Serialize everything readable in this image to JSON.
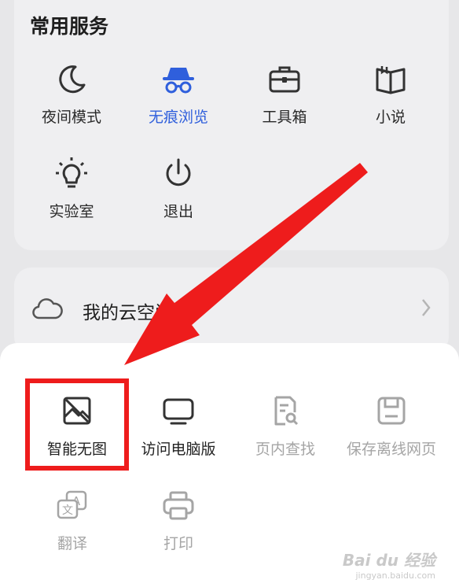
{
  "services": {
    "title": "常用服务",
    "items": [
      {
        "label": "夜间模式",
        "icon": "moon-icon"
      },
      {
        "label": "无痕浏览",
        "icon": "incognito-icon"
      },
      {
        "label": "工具箱",
        "icon": "toolbox-icon"
      },
      {
        "label": "小说",
        "icon": "book-icon"
      },
      {
        "label": "实验室",
        "icon": "bulb-icon"
      },
      {
        "label": "退出",
        "icon": "power-icon"
      }
    ]
  },
  "cloud": {
    "label": "我的云空间",
    "icon": "cloud-icon"
  },
  "tools": {
    "items": [
      {
        "label": "智能无图",
        "icon": "no-image-icon"
      },
      {
        "label": "访问电脑版",
        "icon": "monitor-icon"
      },
      {
        "label": "页内查找",
        "icon": "page-search-icon"
      },
      {
        "label": "保存离线网页",
        "icon": "save-offline-icon"
      },
      {
        "label": "翻译",
        "icon": "translate-icon"
      },
      {
        "label": "打印",
        "icon": "print-icon"
      }
    ]
  },
  "colors": {
    "accent": "#2f5fdc",
    "annotation": "#ee1c1c",
    "disabled": "#a5a5a5"
  },
  "watermark": {
    "brand": "Bai du 经验",
    "url": "jingyan.baidu.com"
  }
}
